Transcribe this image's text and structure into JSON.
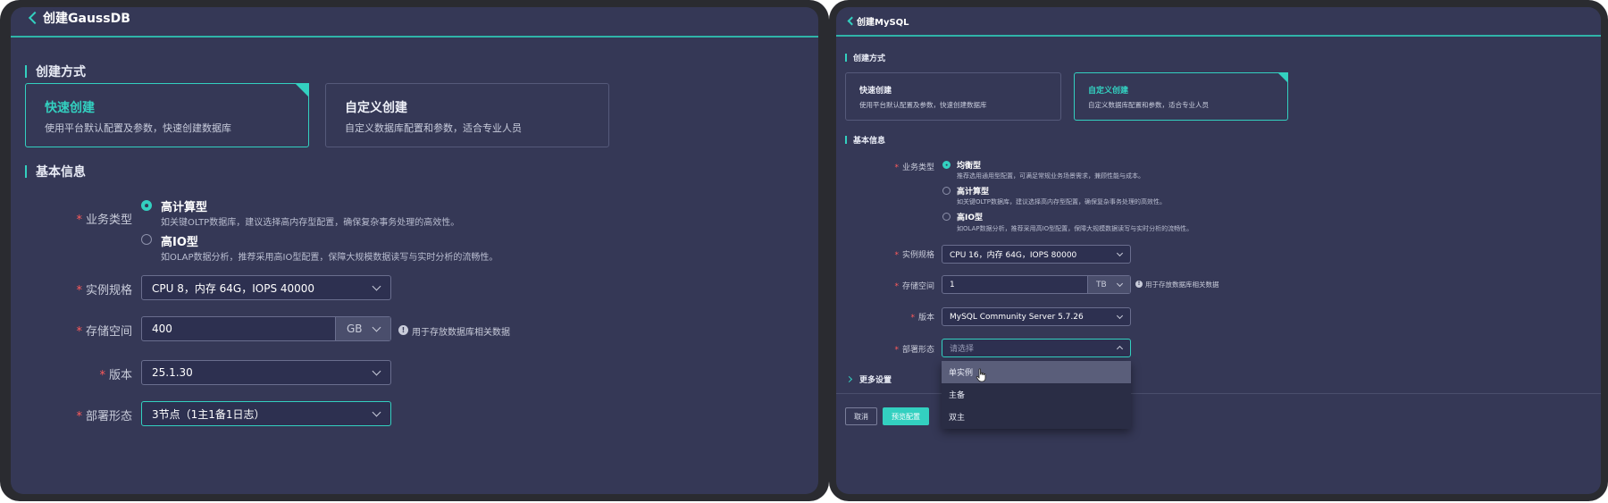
{
  "left": {
    "title": "创建GaussDB",
    "section_create": "创建方式",
    "cards": [
      {
        "title": "快速创建",
        "desc": "使用平台默认配置及参数，快速创建数据库"
      },
      {
        "title": "自定义创建",
        "desc": "自定义数据库配置和参数，适合专业人员"
      }
    ],
    "section_basic": "基本信息",
    "business_type_label": "业务类型",
    "business_options": [
      {
        "title": "高计算型",
        "desc": "如关键OLTP数据库，建议选择高内存型配置，确保复杂事务处理的高效性。"
      },
      {
        "title": "高IO型",
        "desc": "如OLAP数据分析，推荐采用高IO型配置，保障大规模数据读写与实时分析的流畅性。"
      }
    ],
    "spec_label": "实例规格",
    "spec_value": "CPU 8，内存 64G，IOPS 40000",
    "storage_label": "存储空间",
    "storage_value": "400",
    "storage_unit": "GB",
    "storage_hint": "用于存放数据库相关数据",
    "version_label": "版本",
    "version_value": "25.1.30",
    "deploy_label": "部署形态",
    "deploy_value": "3节点（1主1备1日志）"
  },
  "right": {
    "title": "创建MySQL",
    "section_create": "创建方式",
    "cards": [
      {
        "title": "快速创建",
        "desc": "使用平台默认配置及参数，快速创建数据库"
      },
      {
        "title": "自定义创建",
        "desc": "自定义数据库配置和参数，适合专业人员"
      }
    ],
    "section_basic": "基本信息",
    "business_type_label": "业务类型",
    "business_options": [
      {
        "title": "均衡型",
        "desc": "推荐选用通用型配置，可满足常规业务场景需求，兼顾性能与成本。"
      },
      {
        "title": "高计算型",
        "desc": "如关键OLTP数据库，建议选择高内存型配置，确保复杂事务处理的高效性。"
      },
      {
        "title": "高IO型",
        "desc": "如OLAP数据分析，推荐采用高IO型配置，保障大规模数据读写与实时分析的流畅性。"
      }
    ],
    "spec_label": "实例规格",
    "spec_value": "CPU 16，内存 64G，IOPS 80000",
    "storage_label": "存储空间",
    "storage_value": "1",
    "storage_unit": "TB",
    "storage_hint": "用于存放数据库相关数据",
    "version_label": "版本",
    "version_value": "MySQL Community Server 5.7.26",
    "deploy_label": "部署形态",
    "deploy_placeholder": "请选择",
    "deploy_options": [
      "单实例",
      "主备",
      "双主"
    ],
    "more_settings": "更多设置",
    "cancel_label": "取消",
    "preview_label": "预览配置"
  },
  "icons": {
    "back": "back-chevron-icon",
    "info": "info-icon",
    "dropdown": "chevron-down-icon",
    "pointer": "hand-pointer-icon"
  },
  "colors": {
    "accent": "#33d0c0",
    "background": "#353856",
    "required": "#ff5a5a"
  }
}
